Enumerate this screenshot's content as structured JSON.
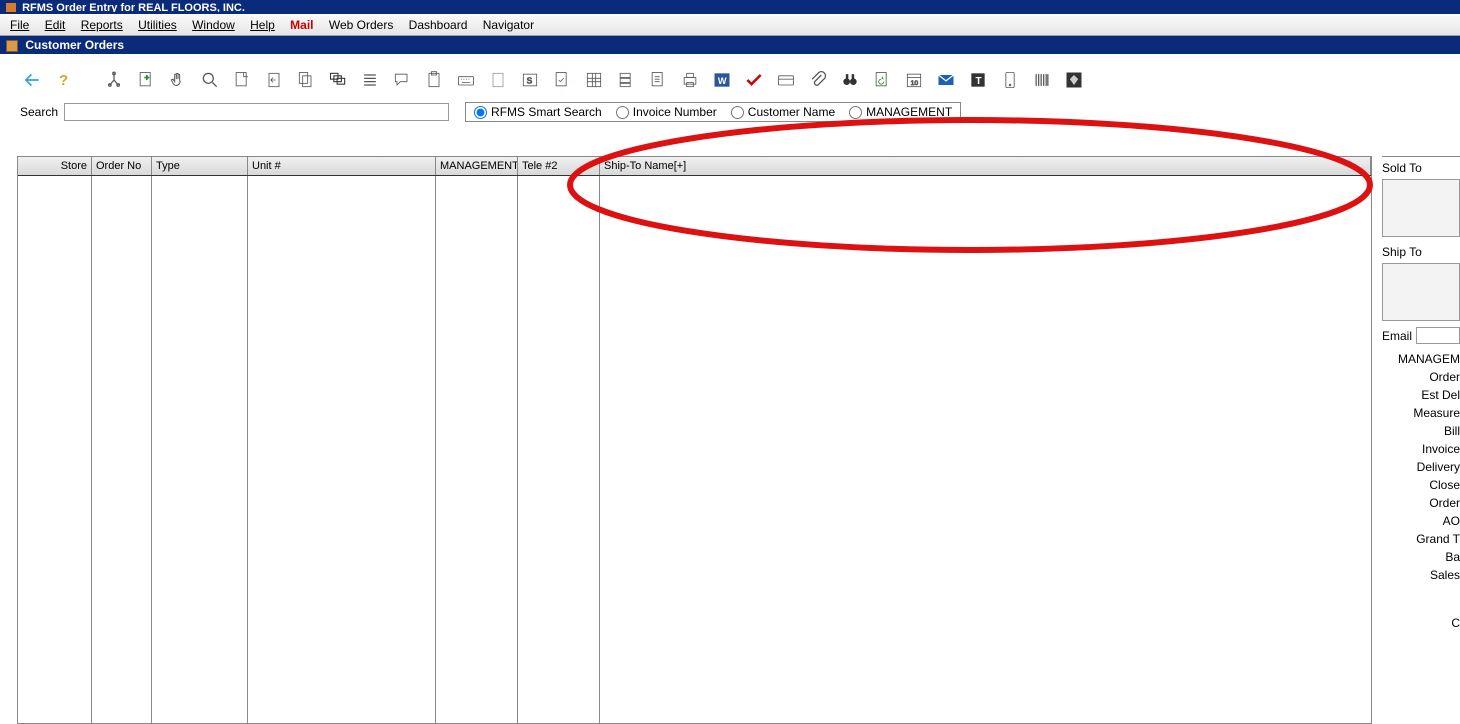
{
  "app_title": "RFMS Order Entry for REAL FLOORS, INC.",
  "menu": {
    "file": "File",
    "edit": "Edit",
    "reports": "Reports",
    "utilities": "Utilities",
    "window": "Window",
    "help": "Help",
    "mail": "Mail",
    "weborders": "Web Orders",
    "dashboard": "Dashboard",
    "navigator": "Navigator"
  },
  "sub_title": "Customer Orders",
  "search": {
    "label": "Search",
    "value": ""
  },
  "search_options": {
    "opt1": "RFMS Smart Search",
    "opt2": "Invoice Number",
    "opt3": "Customer Name",
    "opt4": "MANAGEMENT"
  },
  "grid": {
    "headers": {
      "store": "Store",
      "orderno": "Order No",
      "type": "Type",
      "unitnum": "Unit #",
      "management": "MANAGEMENT",
      "tele2": "Tele #2",
      "shipto": "Ship-To Name[+]"
    }
  },
  "side": {
    "soldto": "Sold To",
    "shipto": "Ship To",
    "email": "Email",
    "fields": {
      "management": "MANAGEM",
      "order": "Order",
      "estdel": "Est Del",
      "measure": "Measure",
      "bill": "Bill",
      "invoice": "Invoice",
      "delivery": "Delivery",
      "close": "Close",
      "order2": "Order",
      "ao": "AO",
      "grand": "Grand T",
      "ba": "Ba",
      "sales": "Sales",
      "c": "C"
    }
  },
  "toolbar_icons": [
    "back-arrow-icon",
    "help-icon",
    "fork-icon",
    "new-doc-icon",
    "hand-icon",
    "magnify-icon",
    "page-icon",
    "doc-back-icon",
    "copy-icon",
    "multi-window-icon",
    "list-icon",
    "speech-icon",
    "clipboard-icon",
    "keyboard-icon",
    "page-blank-icon",
    "s-box-icon",
    "doc-check-icon",
    "doc-grid-icon",
    "stack-icon",
    "doc-lines-icon",
    "printer-icon",
    "word-icon",
    "red-check-icon",
    "card-icon",
    "paperclip-icon",
    "binoculars-icon",
    "refresh-page-icon",
    "calendar-icon",
    "mail-icon",
    "text-box-icon",
    "device-icon",
    "barcode-icon",
    "diamond-icon"
  ]
}
